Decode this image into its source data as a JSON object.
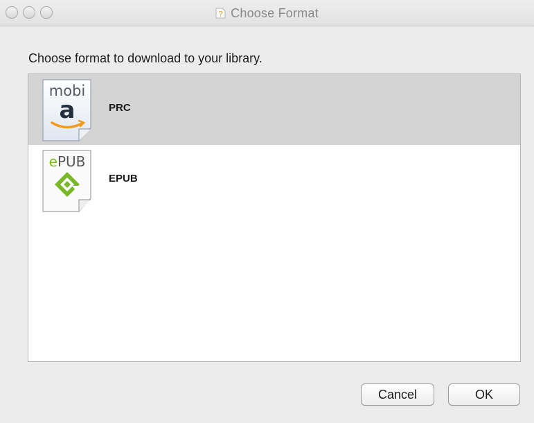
{
  "window": {
    "title": "Choose Format",
    "title_icon": "question-document-icon"
  },
  "dialog": {
    "prompt": "Choose format to download to your library."
  },
  "formats": [
    {
      "label": "PRC",
      "badge": "mobi",
      "badge_glyph": "a",
      "icon": "mobi-file-icon",
      "selected": true
    },
    {
      "label": "EPUB",
      "badge": "ePUB",
      "badge_first_letter": "e",
      "badge_rest": "PUB",
      "icon": "epub-file-icon",
      "selected": false
    }
  ],
  "buttons": {
    "cancel_label": "Cancel",
    "ok_label": "OK"
  },
  "colors": {
    "selection": "#d4d4d4",
    "amazon_orange": "#f39a1e",
    "epub_green": "#7ab829"
  }
}
